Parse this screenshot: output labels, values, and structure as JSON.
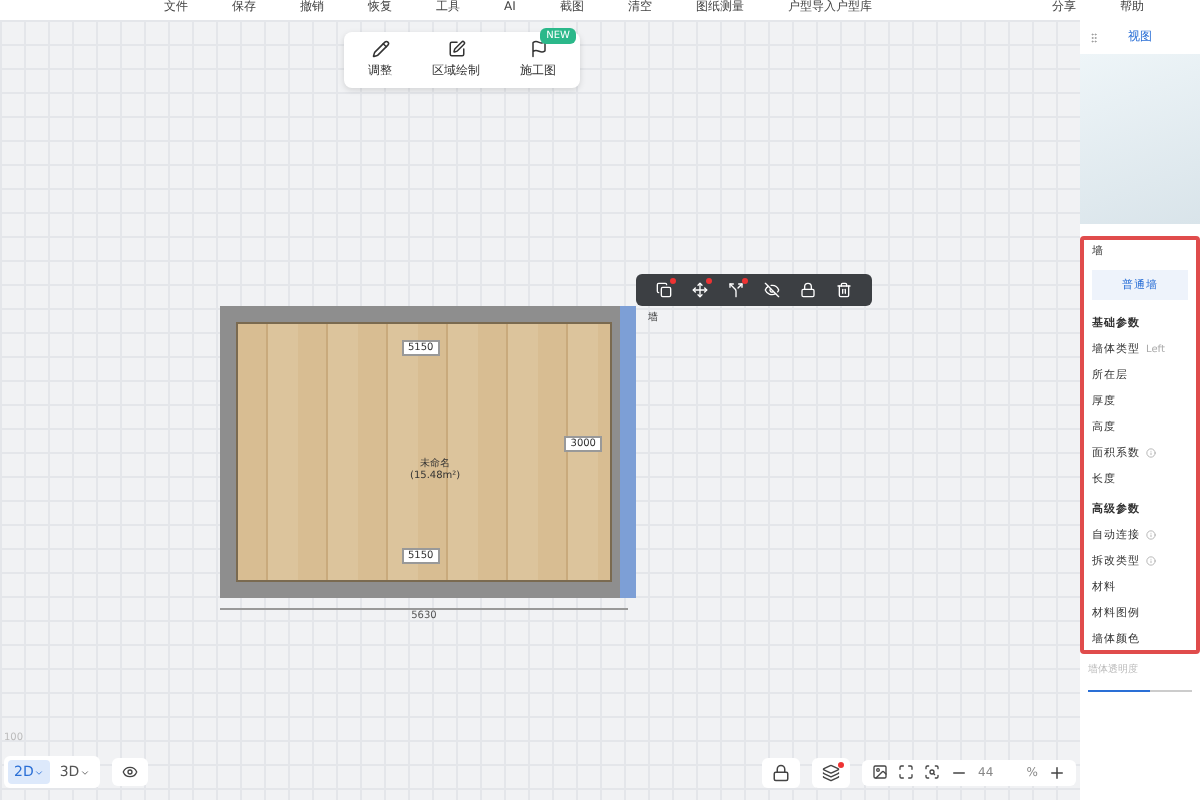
{
  "menu": [
    "文件",
    "保存",
    "撤销",
    "恢复",
    "工具",
    "AI",
    "截图",
    "清空",
    "图纸测量",
    "户型导入户型库"
  ],
  "menu_right": [
    "分享",
    "帮助"
  ],
  "toolbar": [
    {
      "label": "调整"
    },
    {
      "label": "区域绘制"
    },
    {
      "label": "施工图",
      "badge": "NEW"
    }
  ],
  "plan": {
    "top_dim": "5150",
    "bottom_dim": "5150",
    "side_dim": "3000",
    "width_dim": "5630",
    "room_name": "未命名",
    "room_area": "(15.48m²)"
  },
  "float_label": "墙",
  "view_panel": {
    "title": "视图"
  },
  "props": {
    "title": "墙",
    "wall_type_button": "普通墙",
    "sections": [
      {
        "title": "基础参数",
        "rows": [
          {
            "label": "墙体类型",
            "hint": "Left",
            "info": false
          },
          {
            "label": "所在层",
            "info": false
          },
          {
            "label": "厚度",
            "info": false
          },
          {
            "label": "高度",
            "info": false
          },
          {
            "label": "面积系数",
            "info": true
          },
          {
            "label": "长度",
            "info": false
          }
        ]
      },
      {
        "title": "高级参数",
        "rows": [
          {
            "label": "自动连接",
            "info": true
          },
          {
            "label": "拆改类型",
            "info": true
          },
          {
            "label": "材料",
            "info": false
          },
          {
            "label": "材料图例",
            "info": false
          },
          {
            "label": "墙体颜色",
            "info": false
          }
        ]
      }
    ],
    "extra": "墙体透明度",
    "slider": {
      "level": 0.6
    }
  },
  "view_modes": [
    {
      "label": "2D",
      "selected": true
    },
    {
      "label": "3D",
      "selected": false
    }
  ],
  "zoom": {
    "value": "44",
    "unit": "%"
  },
  "corner_label": "100"
}
